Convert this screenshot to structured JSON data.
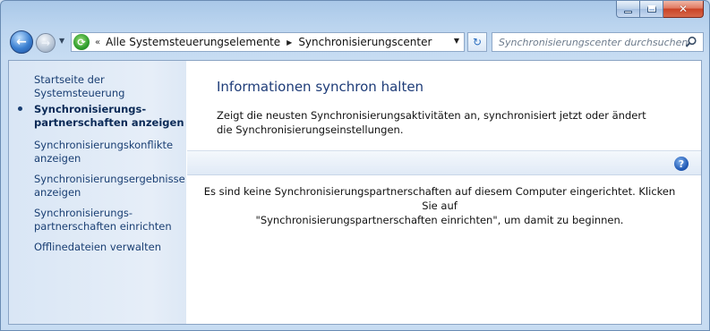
{
  "nav": {
    "breadcrumb_overflow": "«",
    "breadcrumbs": [
      "Alle Systemsteuerungselemente",
      "Synchronisierungscenter"
    ],
    "search_placeholder": "Synchronisierungscenter durchsuchen"
  },
  "sidebar": {
    "items": [
      {
        "label": "Startseite der Systemsteuerung"
      },
      {
        "label": "Synchronisierungs-\npartnerschaften anzeigen",
        "active": true
      },
      {
        "label": "Synchronisierungskonflikte anzeigen"
      },
      {
        "label": "Synchronisierungsergebnisse anzeigen"
      },
      {
        "label": "Synchronisierungs-\npartnerschaften einrichten"
      },
      {
        "label": "Offlinedateien verwalten"
      }
    ]
  },
  "main": {
    "title": "Informationen synchron halten",
    "description": "Zeigt die neusten Synchronisierungsaktivitäten an, synchronisiert jetzt oder ändert die Synchronisierungseinstellungen.",
    "empty_message_line1": "Es sind keine Synchronisierungspartnerschaften auf diesem Computer eingerichtet. Klicken Sie auf",
    "empty_message_line2": "\"Synchronisierungspartnerschaften einrichten\", um damit zu beginnen."
  },
  "icons": {
    "help": "?",
    "back": "←",
    "forward": "→",
    "refresh": "↻",
    "close": "✕"
  },
  "colors": {
    "link": "#1a3f73",
    "title": "#1e3c78",
    "close_button": "#c94326"
  }
}
